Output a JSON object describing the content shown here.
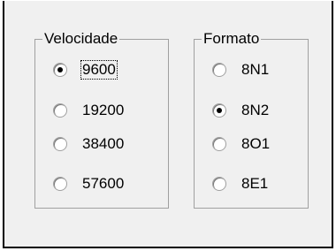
{
  "speed_group": {
    "title": "Velocidade",
    "options": [
      {
        "label": "9600",
        "checked": true,
        "focused": true
      },
      {
        "label": "19200",
        "checked": false,
        "focused": false
      },
      {
        "label": "38400",
        "checked": false,
        "focused": false
      },
      {
        "label": "57600",
        "checked": false,
        "focused": false
      }
    ]
  },
  "format_group": {
    "title": "Formato",
    "options": [
      {
        "label": "8N1",
        "checked": false,
        "focused": false
      },
      {
        "label": "8N2",
        "checked": true,
        "focused": false
      },
      {
        "label": "8O1",
        "checked": false,
        "focused": false
      },
      {
        "label": "8E1",
        "checked": false,
        "focused": false
      }
    ]
  }
}
